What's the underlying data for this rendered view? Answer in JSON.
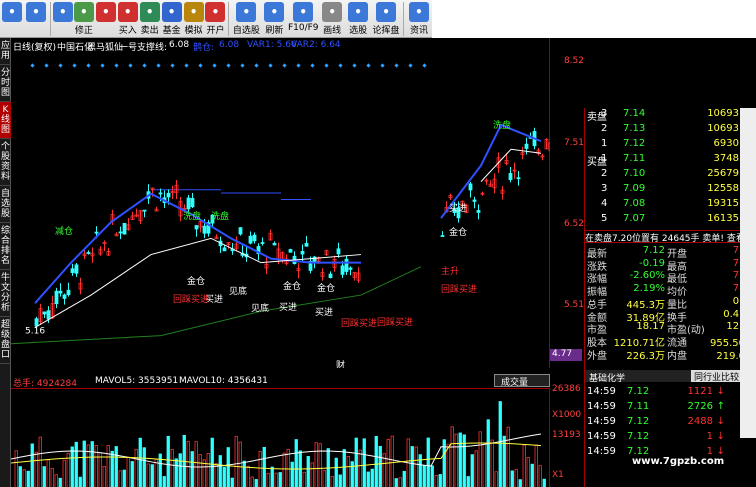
{
  "toolbar": {
    "buttons": [
      {
        "label": "",
        "icon": "back-icon",
        "color": "#3c78d8"
      },
      {
        "label": "",
        "icon": "forward-icon",
        "color": "#3c78d8"
      },
      {
        "label": "",
        "icon": "up-icon",
        "color": "#3c78d8"
      },
      {
        "label": "修正",
        "icon": "refresh-icon",
        "color": "#4a9a4a"
      },
      {
        "label": "",
        "icon": "no-icon",
        "color": "#d03030"
      },
      {
        "label": "买入",
        "icon": "buy-icon",
        "color": "#d03030"
      },
      {
        "label": "卖出",
        "icon": "sell-icon",
        "color": "#2e8b57"
      },
      {
        "label": "基金",
        "icon": "fund-icon",
        "color": "#3366cc"
      },
      {
        "label": "模拟",
        "icon": "hammer-icon",
        "color": "#b8860b"
      },
      {
        "label": "开户",
        "icon": "flag-icon",
        "color": "#d03030"
      },
      {
        "label": "自选股",
        "icon": "star-list-icon",
        "color": "#3c78d8"
      },
      {
        "label": "刷新",
        "icon": "refresh-list-icon",
        "color": "#3c78d8"
      },
      {
        "label": "F10/F9",
        "icon": "f10-icon",
        "color": "#3c78d8"
      },
      {
        "label": "画线",
        "icon": "pen-icon",
        "color": "#888888"
      },
      {
        "label": "选股",
        "icon": "pick-icon",
        "color": "#3c78d8"
      },
      {
        "label": "论挥盘",
        "icon": "chat-icon",
        "color": "#3c78d8"
      },
      {
        "label": "资讯",
        "icon": "news-icon",
        "color": "#3c78d8"
      }
    ]
  },
  "vtabs": [
    "应用",
    "分时图",
    "K线图",
    "个股资料",
    "自选股",
    "综合排名",
    "牛文分析",
    "超级盘口"
  ],
  "vtab_active": 2,
  "header": {
    "period": "日线(复权)",
    "stock": "中国石化",
    "indicator": "黑马狐仙",
    "support_label": "一号支撑线:",
    "support_value": "6.08",
    "var_a_label": "鹊仓:",
    "var_a_value": "6.08",
    "var1": "VAR1: 5.66",
    "var2": "VAR2: 6.64"
  },
  "chart_data": {
    "type": "candlestick",
    "price_axis": {
      "ticks": [
        8.52,
        7.51,
        6.52,
        5.51
      ],
      "ylim": [
        4.7,
        8.6
      ]
    },
    "low_price": "4.77",
    "low_marker": "5.16",
    "annotations": [
      {
        "text": "减仓",
        "color": "#30ff30"
      },
      {
        "text": "洗盘",
        "color": "#30ff30"
      },
      {
        "text": "洗盘",
        "color": "#30ff30"
      },
      {
        "text": "金仓",
        "color": "#ffffff"
      },
      {
        "text": "买进",
        "color": "#ffffff"
      },
      {
        "text": "见底",
        "color": "#ffffff"
      },
      {
        "text": "金仓",
        "color": "#ffffff"
      },
      {
        "text": "金仓",
        "color": "#ffffff"
      },
      {
        "text": "回踩买进",
        "color": "#ff3030"
      },
      {
        "text": "见底",
        "color": "#ffffff"
      },
      {
        "text": "买进",
        "color": "#ffffff"
      },
      {
        "text": "买进",
        "color": "#ffffff"
      },
      {
        "text": "回踩买进",
        "color": "#ff3030"
      },
      {
        "text": "回踩买进",
        "color": "#ff3030"
      },
      {
        "text": "主升",
        "color": "#ff3030"
      },
      {
        "text": "回踩买进",
        "color": "#ff3030"
      },
      {
        "text": "洗盘",
        "color": "#30ff30"
      },
      {
        "text": "金仓",
        "color": "#ffffff"
      },
      {
        "text": "买进",
        "color": "#ffffff"
      },
      {
        "text": "财",
        "color": "#ffffff"
      }
    ]
  },
  "volume": {
    "total": "总手: 4924284",
    "mavol5": "MAVOL5: 3553951",
    "mavol10": "MAVOL10: 4356431",
    "selector": "成交量",
    "axis": [
      "26386",
      "X1000",
      "13193",
      "X1"
    ]
  },
  "orderbook": {
    "sell": [
      {
        "side": "卖盘",
        "level": "3",
        "price": "7.14",
        "vol": "10693"
      },
      {
        "side": "",
        "level": "2",
        "price": "7.13",
        "vol": "10693"
      },
      {
        "side": "",
        "level": "1",
        "price": "7.12",
        "vol": "6930"
      }
    ],
    "buy": [
      {
        "side": "买盘",
        "level": "1",
        "price": "7.11",
        "vol": "3748"
      },
      {
        "side": "",
        "level": "2",
        "price": "7.10",
        "vol": "25679"
      },
      {
        "side": "",
        "level": "3",
        "price": "7.09",
        "vol": "12558"
      },
      {
        "side": "",
        "level": "4",
        "price": "7.08",
        "vol": "19315"
      },
      {
        "side": "",
        "level": "5",
        "price": "7.07",
        "vol": "16135"
      }
    ],
    "summary": "在卖盘7.20位置有 24645手 卖单! 查看详细",
    "stats": [
      {
        "l1": "最新",
        "v1": "7.12",
        "l2": "开盘",
        "v2": "7.22"
      },
      {
        "l1": "涨跌",
        "v1": "-0.19",
        "l2": "最高",
        "v2": "7.24"
      },
      {
        "l1": "涨幅",
        "v1": "-2.60%",
        "l2": "最低",
        "v2": "7.06"
      },
      {
        "l1": "振幅",
        "v1": "2.19%",
        "l2": "均价",
        "v2": "7.11"
      },
      {
        "l1": "总手",
        "v1": "445.3万",
        "l2": "量比",
        "v2": "0.75"
      },
      {
        "l1": "金额",
        "v1": "31.89亿",
        "l2": "换手",
        "v2": "0.47%"
      },
      {
        "l1": "市盈",
        "v1": "18.17",
        "l2": "市盈(动)",
        "v2": "127.9"
      },
      {
        "l1": "股本",
        "v1": "1210.71亿",
        "l2": "流通",
        "v2": "955.50亿"
      },
      {
        "l1": "外盘",
        "v1": "226.3万",
        "l2": "内盘",
        "v2": "219.0万"
      }
    ]
  },
  "ticks": {
    "tab1": "基础化学",
    "tab2": "同行业比较",
    "rows": [
      {
        "time": "14:59",
        "price": "7.12",
        "vol": "1121",
        "dir": "down"
      },
      {
        "time": "14:59",
        "price": "7.11",
        "vol": "2726",
        "dir": "up"
      },
      {
        "time": "14:59",
        "price": "7.12",
        "vol": "2488",
        "dir": "down"
      },
      {
        "time": "14:59",
        "price": "7.12",
        "vol": "1",
        "dir": "down"
      },
      {
        "time": "14:59",
        "price": "7.12",
        "vol": "1",
        "dir": "down"
      }
    ]
  },
  "watermark": "www.7gpzb.com"
}
